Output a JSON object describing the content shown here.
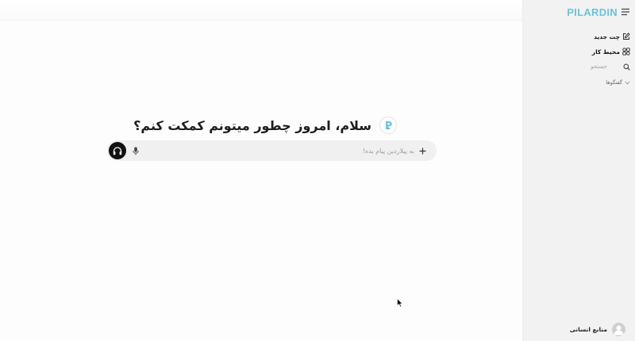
{
  "main": {
    "greeting": "سلام، امروز چطور میتونم کمکت کنم؟",
    "composer": {
      "placeholder": "به پیلاردین پیام بده!",
      "value": ""
    }
  },
  "sidebar": {
    "brand": "PILARDIN",
    "items": [
      {
        "label": "چت جدید",
        "icon": "edit-icon"
      },
      {
        "label": "محیط کار",
        "icon": "workspace-icon"
      },
      {
        "label": "جستجو",
        "icon": "search-icon"
      },
      {
        "label": "گفتگوها",
        "icon": "chevron-down-icon"
      }
    ],
    "user": {
      "name": "منابع انسانی"
    }
  },
  "colors": {
    "brand": "#6cc3d9",
    "sidebar_bg": "#f2f2f2",
    "composer_bg": "#f0f0f0",
    "voice_button": "#111111"
  }
}
